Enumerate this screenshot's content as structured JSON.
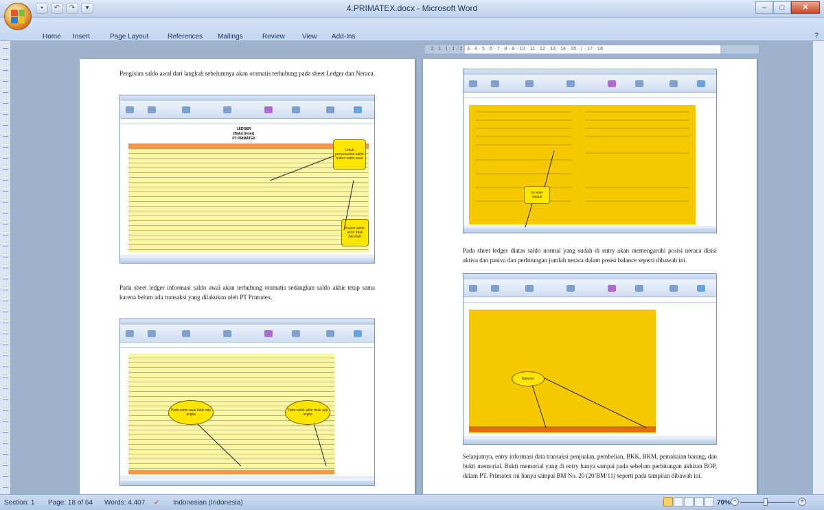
{
  "window": {
    "title": "4.PRIMATEX.docx - Microsoft Word",
    "controls": {
      "minimize": "–",
      "maximize": "□",
      "close": "✕"
    }
  },
  "quick_access": [
    {
      "icon": "save-icon",
      "glyph": "▪"
    },
    {
      "icon": "undo-icon",
      "glyph": "↶"
    },
    {
      "icon": "redo-icon",
      "glyph": "↷"
    },
    {
      "icon": "customize-icon",
      "glyph": "▾"
    }
  ],
  "ribbon": {
    "tabs": [
      "Home",
      "Insert",
      "Page Layout",
      "References",
      "Mailings",
      "Review",
      "View",
      "Add-Ins"
    ],
    "help_glyph": "?"
  },
  "ruler": {
    "horizontal_labels": "· 2 · 1 · | · 1 · 2 · 3 · 4 · 5 · 6 · 7 · 8 · 9 · 10 · 11 · 12 · 13 · 14 · 15 · | · 17 · 18"
  },
  "left_page": {
    "para1": "Pengisian saldo awal dari langkah sebelumnya akan otomatis terhubung pada sheet Ledger dan Neraca.",
    "shot1": {
      "heading_lines": [
        "LEDGER",
        "(Buku besar)",
        "PT PRIMATEX"
      ],
      "callout_top": "Untuk penyesuaian saldo kolom saldo awal",
      "callout_bottom": "Kolom saldo akhir tidak berubah"
    },
    "para2": "Pada sheet ledger informasi saldo awal akan terhubung otomatis sedangkan saldo akhir tetap sama karena belum ada transaksi yang dilakukan oleh PT Primatex.",
    "shot2": {
      "callout_left": "Pada saldo awal tidak ada angka",
      "callout_right": "Pada saldo akhir tidak ada angka"
    }
  },
  "right_page": {
    "shot3": {
      "callout": "Ini akan masuk"
    },
    "para1": "Pada sheet ledger diatas saldo normal yang sudah di entry akan memengaruhi posisi neraca disisi aktiva dan pasiva dan perhitungan jumlah neraca dalam posisi balance seperti dibawah ini.",
    "shot4": {
      "callout": "Balance"
    },
    "para2": "Selanjutnya, entry informasi data transaksi penjualan, pembelian, BKK, BKM, pemakaian barang, dan bukti memorial. Bukti memorial yang di entry hanya sampai pada sebelum perhitungan akhiran BOP, dalam PT. Primatex ini hanya sampai BM No. 20 (20/BM/11) seperti pada tampilan dibawah ini."
  },
  "statusbar": {
    "section": "Section: 1",
    "page": "Page: 18 of 64",
    "words": "Words: 4.407",
    "language": "Indonesian (Indonesia)",
    "zoom": "70%"
  },
  "colors": {
    "excel_yellow": "#f6c800",
    "excel_header_orange": "#f79646",
    "callout_yellow": "#ffe600",
    "ribbon_blue": "#c3d6f0"
  }
}
